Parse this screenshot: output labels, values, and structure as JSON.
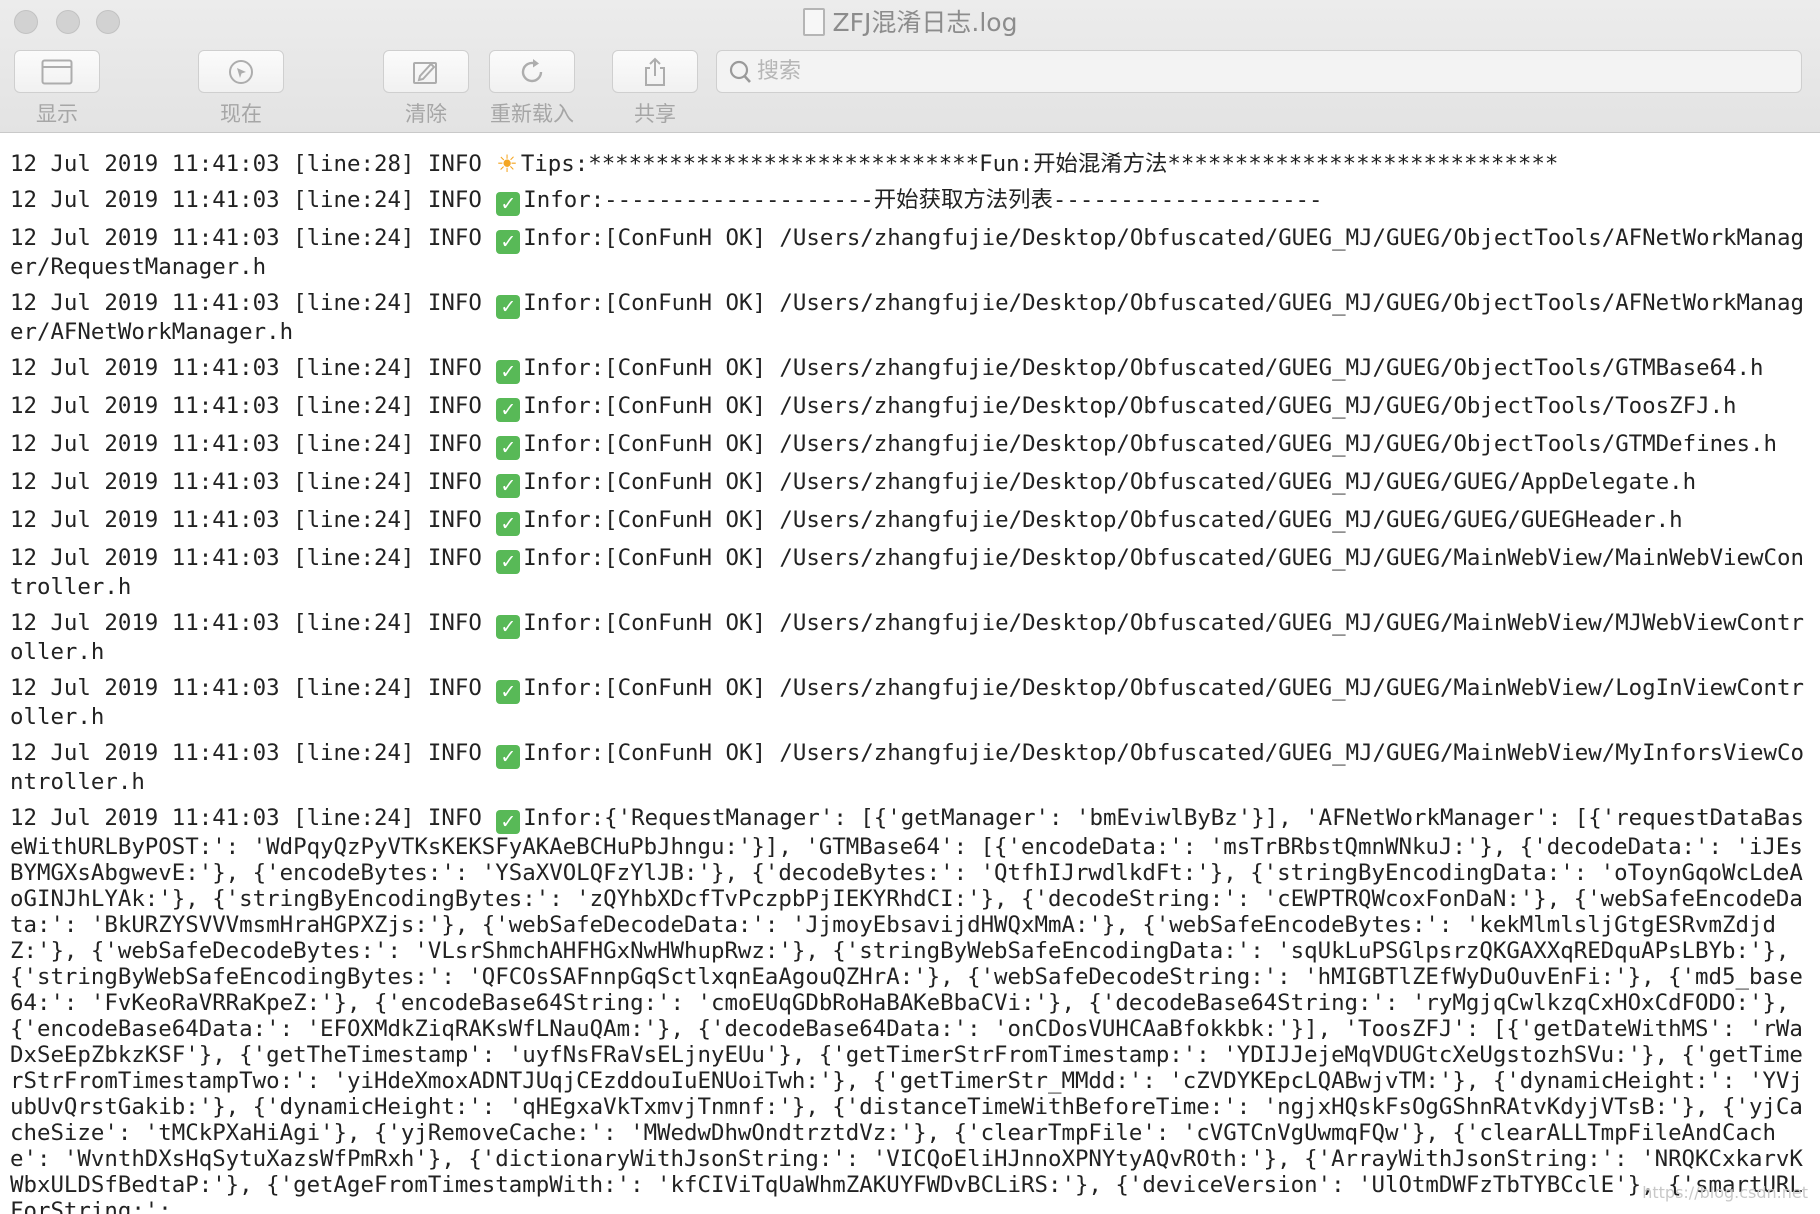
{
  "window": {
    "title": "ZFJ混淆日志.log"
  },
  "toolbar": {
    "show_label": "显示",
    "now_label": "现在",
    "clear_label": "清除",
    "reload_label": "重新载入",
    "share_label": "共享"
  },
  "search": {
    "placeholder": "搜索"
  },
  "log": {
    "entries": [
      {
        "prefix": "12 Jul 2019 11:41:03 [line:28] INFO ",
        "icon": "sun-icon",
        "text": "Tips:*****************************Fun:开始混淆方法*****************************"
      },
      {
        "prefix": "12 Jul 2019 11:41:03 [line:24] INFO ",
        "icon": "check-icon",
        "text": "Infor:--------------------开始获取方法列表--------------------"
      },
      {
        "prefix": "12 Jul 2019 11:41:03 [line:24] INFO ",
        "icon": "check-icon",
        "text": "Infor:[ConFunH OK] /Users/zhangfujie/Desktop/Obfuscated/GUEG_MJ/GUEG/ObjectTools/AFNetWorkManager/RequestManager.h"
      },
      {
        "prefix": "12 Jul 2019 11:41:03 [line:24] INFO ",
        "icon": "check-icon",
        "text": "Infor:[ConFunH OK] /Users/zhangfujie/Desktop/Obfuscated/GUEG_MJ/GUEG/ObjectTools/AFNetWorkManager/AFNetWorkManager.h"
      },
      {
        "prefix": "12 Jul 2019 11:41:03 [line:24] INFO ",
        "icon": "check-icon",
        "text": "Infor:[ConFunH OK] /Users/zhangfujie/Desktop/Obfuscated/GUEG_MJ/GUEG/ObjectTools/GTMBase64.h"
      },
      {
        "prefix": "12 Jul 2019 11:41:03 [line:24] INFO ",
        "icon": "check-icon",
        "text": "Infor:[ConFunH OK] /Users/zhangfujie/Desktop/Obfuscated/GUEG_MJ/GUEG/ObjectTools/ToosZFJ.h"
      },
      {
        "prefix": "12 Jul 2019 11:41:03 [line:24] INFO ",
        "icon": "check-icon",
        "text": "Infor:[ConFunH OK] /Users/zhangfujie/Desktop/Obfuscated/GUEG_MJ/GUEG/ObjectTools/GTMDefines.h"
      },
      {
        "prefix": "12 Jul 2019 11:41:03 [line:24] INFO ",
        "icon": "check-icon",
        "text": "Infor:[ConFunH OK] /Users/zhangfujie/Desktop/Obfuscated/GUEG_MJ/GUEG/GUEG/AppDelegate.h"
      },
      {
        "prefix": "12 Jul 2019 11:41:03 [line:24] INFO ",
        "icon": "check-icon",
        "text": "Infor:[ConFunH OK] /Users/zhangfujie/Desktop/Obfuscated/GUEG_MJ/GUEG/GUEG/GUEGHeader.h"
      },
      {
        "prefix": "12 Jul 2019 11:41:03 [line:24] INFO ",
        "icon": "check-icon",
        "text": "Infor:[ConFunH OK] /Users/zhangfujie/Desktop/Obfuscated/GUEG_MJ/GUEG/MainWebView/MainWebViewController.h"
      },
      {
        "prefix": "12 Jul 2019 11:41:03 [line:24] INFO ",
        "icon": "check-icon",
        "text": "Infor:[ConFunH OK] /Users/zhangfujie/Desktop/Obfuscated/GUEG_MJ/GUEG/MainWebView/MJWebViewController.h"
      },
      {
        "prefix": "12 Jul 2019 11:41:03 [line:24] INFO ",
        "icon": "check-icon",
        "text": "Infor:[ConFunH OK] /Users/zhangfujie/Desktop/Obfuscated/GUEG_MJ/GUEG/MainWebView/LogInViewController.h"
      },
      {
        "prefix": "12 Jul 2019 11:41:03 [line:24] INFO ",
        "icon": "check-icon",
        "text": "Infor:[ConFunH OK] /Users/zhangfujie/Desktop/Obfuscated/GUEG_MJ/GUEG/MainWebView/MyInforsViewController.h"
      },
      {
        "prefix": "12 Jul 2019 11:41:03 [line:24] INFO ",
        "icon": "check-icon",
        "text": "Infor:{'RequestManager': [{'getManager': 'bmEviwlByBz'}], 'AFNetWorkManager': [{'requestDataBaseWithURLByPOST:': 'WdPqyQzPyVTKsKEKSFyAKAeBCHuPbJhngu:'}], 'GTMBase64': [{'encodeData:': 'msTrBRbstQmnWNkuJ:'}, {'decodeData:': 'iJEsBYMGXsAbgwevE:'}, {'encodeBytes:': 'YSaXVOLQFzYlJB:'}, {'decodeBytes:': 'QtfhIJrwdlkdFt:'}, {'stringByEncodingData:': 'oToynGqoWcLdeAoGINJhLYAk:'}, {'stringByEncodingBytes:': 'zQYhbXDcfTvPczpbPjIEKYRhdCI:'}, {'decodeString:': 'cEWPTRQWcoxFonDaN:'}, {'webSafeEncodeData:': 'BkURZYSVVVmsmHraHGPXZjs:'}, {'webSafeDecodeData:': 'JjmoyEbsavijdHWQxMmA:'}, {'webSafeEncodeBytes:': 'kekMlmlsljGtgESRvmZdjdZ:'}, {'webSafeDecodeBytes:': 'VLsrShmchAHFHGxNwHWhupRwz:'}, {'stringByWebSafeEncodingData:': 'sqUkLuPSGlpsrzQKGAXXqREDquAPsLBYb:'}, {'stringByWebSafeEncodingBytes:': 'QFCOsSAFnnpGqSctlxqnEaAgouQZHrA:'}, {'webSafeDecodeString:': 'hMIGBTlZEfWyDuOuvEnFi:'}, {'md5_base64:': 'FvKeoRaVRRaKpeZ:'}, {'encodeBase64String:': 'cmoEUqGDbRoHaBAKeBbaCVi:'}, {'decodeBase64String:': 'ryMgjqCwlkzqCxHOxCdFODO:'}, {'encodeBase64Data:': 'EFOXMdkZiqRAKsWfLNauQAm:'}, {'decodeBase64Data:': 'onCDosVUHCAaBfokkbk:'}], 'ToosZFJ': [{'getDateWithMS': 'rWaDxSeEpZbkzKSF'}, {'getTheTimestamp': 'uyfNsFRaVsELjnyEUu'}, {'getTimerStrFromTimestamp:': 'YDIJJejeMqVDUGtcXeUgstozhSVu:'}, {'getTimerStrFromTimestampTwo:': 'yiHdeXmoxADNTJUqjCEzddouIuENUoiTwh:'}, {'getTimerStr_MMdd:': 'cZVDYKEpcLQABwjvTM:'}, {'dynamicHeight:': 'YVjubUvQrstGakib:'}, {'dynamicHeight:': 'qHEgxaVkTxmvjTnmnf:'}, {'distanceTimeWithBeforeTime:': 'ngjxHQskFsOgGShnRAtvKdyjVTsB:'}, {'yjCacheSize': 'tMCkPXaHiAgi'}, {'yjRemoveCache:': 'MWedwDhwOndtrztdVz:'}, {'clearTmpFile': 'cVGTCnVgUwmqFQw'}, {'clearALLTmpFileAndCache': 'WvnthDXsHqSytuXazsWfPmRxh'}, {'dictionaryWithJsonString:': 'VICQoEliHJnnoXPNYtyAQvROth:'}, {'ArrayWithJsonString:': 'NRQKCxkarvKWbxULDSfBedtaP:'}, {'getAgeFromTimestampWith:': 'kfCIViTqUaWhmZAKUYFWDvBCLiRS:'}, {'deviceVersion': 'UlOtmDWFzTbTYBCclE'}, {'smartURLForString:':"
      }
    ]
  },
  "watermark": "https://blog.csdn.net"
}
